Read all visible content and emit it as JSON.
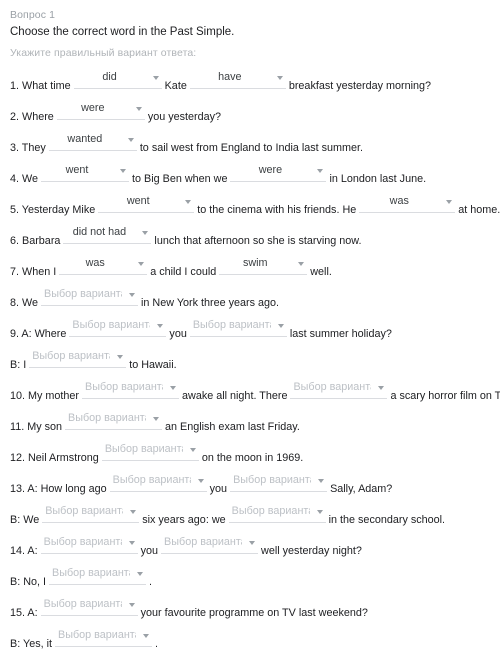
{
  "header": {
    "question_number": "Вопрос 1",
    "title": "Choose the correct word in the Past Simple.",
    "hint": "Укажите правильный вариант ответа:"
  },
  "placeholder": "Выбор варианта",
  "colors": {
    "text": "#202124",
    "muted": "#9aa0a6",
    "placeholder": "#bdc1c6",
    "underline": "#dadce0",
    "background": "#ffffff"
  },
  "rows": [
    {
      "id": "row-1",
      "parts": [
        {
          "type": "text",
          "value": "1. What time"
        },
        {
          "type": "select",
          "value": "did",
          "size": "filled"
        },
        {
          "type": "text",
          "value": "Kate"
        },
        {
          "type": "select",
          "value": "have",
          "size": "filled2"
        },
        {
          "type": "text",
          "value": "breakfast yesterday morning?"
        }
      ]
    },
    {
      "id": "row-2",
      "parts": [
        {
          "type": "text",
          "value": "2. Where"
        },
        {
          "type": "select",
          "value": "were",
          "size": "filled"
        },
        {
          "type": "text",
          "value": "you yesterday?"
        }
      ]
    },
    {
      "id": "row-3",
      "parts": [
        {
          "type": "text",
          "value": "3. They"
        },
        {
          "type": "select",
          "value": "wanted",
          "size": "filled"
        },
        {
          "type": "text",
          "value": "to sail west from England to India last summer."
        }
      ]
    },
    {
      "id": "row-4",
      "parts": [
        {
          "type": "text",
          "value": "4. We"
        },
        {
          "type": "select",
          "value": "went",
          "size": "filled"
        },
        {
          "type": "text",
          "value": "to Big Ben when we"
        },
        {
          "type": "select",
          "value": "were",
          "size": "filled2"
        },
        {
          "type": "text",
          "value": "in London last June."
        }
      ]
    },
    {
      "id": "row-5",
      "parts": [
        {
          "type": "text",
          "value": "5. Yesterday Mike"
        },
        {
          "type": "select",
          "value": "went",
          "size": "filled2"
        },
        {
          "type": "text",
          "value": "to the cinema with his friends. He"
        },
        {
          "type": "select",
          "value": "was",
          "size": "filled2"
        },
        {
          "type": "text",
          "value": "at home."
        }
      ]
    },
    {
      "id": "row-6",
      "parts": [
        {
          "type": "text",
          "value": "6. Barbara"
        },
        {
          "type": "select",
          "value": "did not had",
          "size": "filled"
        },
        {
          "type": "text",
          "value": "lunch that afternoon so she is starving now."
        }
      ]
    },
    {
      "id": "row-7",
      "parts": [
        {
          "type": "text",
          "value": "7. When I"
        },
        {
          "type": "select",
          "value": "was",
          "size": "filled"
        },
        {
          "type": "text",
          "value": "a child I could"
        },
        {
          "type": "select",
          "value": "swim",
          "size": "filled"
        },
        {
          "type": "text",
          "value": "well."
        }
      ]
    },
    {
      "id": "row-8",
      "parts": [
        {
          "type": "text",
          "value": "8. We"
        },
        {
          "type": "select",
          "value": "",
          "size": "ph"
        },
        {
          "type": "text",
          "value": "in New York three years ago."
        }
      ]
    },
    {
      "id": "row-9",
      "parts": [
        {
          "type": "text",
          "value": "9. A: Where"
        },
        {
          "type": "select",
          "value": "",
          "size": "ph"
        },
        {
          "type": "text",
          "value": "you"
        },
        {
          "type": "select",
          "value": "",
          "size": "ph"
        },
        {
          "type": "text",
          "value": "last summer holiday?"
        }
      ]
    },
    {
      "id": "row-9b",
      "parts": [
        {
          "type": "text",
          "value": "B: I"
        },
        {
          "type": "select",
          "value": "",
          "size": "ph"
        },
        {
          "type": "text",
          "value": "to Hawaii."
        }
      ]
    },
    {
      "id": "row-10",
      "parts": [
        {
          "type": "text",
          "value": "10. My mother"
        },
        {
          "type": "select",
          "value": "",
          "size": "ph"
        },
        {
          "type": "text",
          "value": "awake all night. There"
        },
        {
          "type": "select",
          "value": "",
          "size": "ph"
        },
        {
          "type": "text",
          "value": "a scary horror film on TV."
        }
      ]
    },
    {
      "id": "row-11",
      "parts": [
        {
          "type": "text",
          "value": "11. My son"
        },
        {
          "type": "select",
          "value": "",
          "size": "ph"
        },
        {
          "type": "text",
          "value": "an English exam last Friday."
        }
      ]
    },
    {
      "id": "row-12",
      "parts": [
        {
          "type": "text",
          "value": "12. Neil Armstrong"
        },
        {
          "type": "select",
          "value": "",
          "size": "ph"
        },
        {
          "type": "text",
          "value": "on the moon in 1969."
        }
      ]
    },
    {
      "id": "row-13",
      "parts": [
        {
          "type": "text",
          "value": "13. A: How long ago"
        },
        {
          "type": "select",
          "value": "",
          "size": "ph"
        },
        {
          "type": "text",
          "value": "you"
        },
        {
          "type": "select",
          "value": "",
          "size": "ph"
        },
        {
          "type": "text",
          "value": "Sally, Adam?"
        }
      ]
    },
    {
      "id": "row-13b",
      "parts": [
        {
          "type": "text",
          "value": "B: We"
        },
        {
          "type": "select",
          "value": "",
          "size": "ph"
        },
        {
          "type": "text",
          "value": "six years ago: we"
        },
        {
          "type": "select",
          "value": "",
          "size": "ph"
        },
        {
          "type": "text",
          "value": "in the secondary school."
        }
      ]
    },
    {
      "id": "row-14",
      "parts": [
        {
          "type": "text",
          "value": "14. A:"
        },
        {
          "type": "select",
          "value": "",
          "size": "ph"
        },
        {
          "type": "text",
          "value": "you"
        },
        {
          "type": "select",
          "value": "",
          "size": "ph"
        },
        {
          "type": "text",
          "value": "well yesterday night?"
        }
      ]
    },
    {
      "id": "row-14b",
      "parts": [
        {
          "type": "text",
          "value": "B: No, I"
        },
        {
          "type": "select",
          "value": "",
          "size": "ph"
        },
        {
          "type": "text",
          "value": "."
        }
      ]
    },
    {
      "id": "row-15",
      "parts": [
        {
          "type": "text",
          "value": "15. A:"
        },
        {
          "type": "select",
          "value": "",
          "size": "ph"
        },
        {
          "type": "text",
          "value": "your favourite programme on TV last weekend?"
        }
      ]
    },
    {
      "id": "row-15b",
      "parts": [
        {
          "type": "text",
          "value": "B: Yes, it"
        },
        {
          "type": "select",
          "value": "",
          "size": "ph"
        },
        {
          "type": "text",
          "value": "."
        }
      ]
    }
  ]
}
